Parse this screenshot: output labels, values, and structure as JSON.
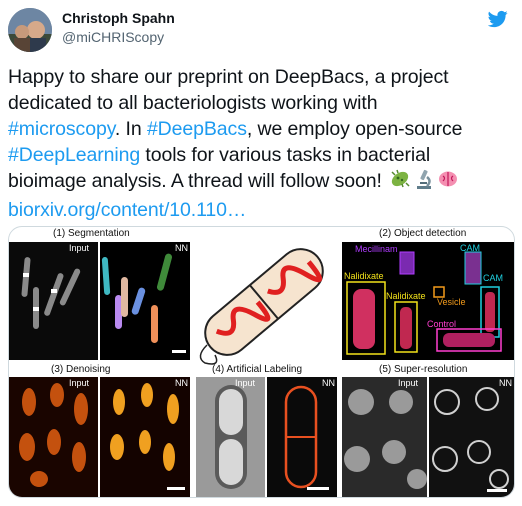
{
  "author": {
    "name": "Christoph Spahn",
    "handle": "@miCHRIScopy"
  },
  "tweet": {
    "line1": "Happy to share our preprint on DeepBacs, a project",
    "line2": "dedicated to all bacteriologists working with",
    "line3_hashtag1": "#microscopy",
    "line3_text1": ". In ",
    "line3_hashtag2": "#DeepBacs",
    "line3_text2": ", we employ open-source",
    "line4_hashtag": "#DeepLearning",
    "line4_text": " tools for various tasks in bacterial",
    "line5": "bioimage analysis. A thread will follow soon!",
    "link": "biorxiv.org/content/10.110…",
    "emojis": [
      "microbe-icon",
      "microscope-icon",
      "brain-icon"
    ]
  },
  "figure": {
    "panels": {
      "segmentation": "(1) Segmentation",
      "object_detection": "(2) Object detection",
      "denoising": "(3) Denoising",
      "artificial_labeling": "(4) Artificial Labeling",
      "super_resolution": "(5) Super-resolution"
    },
    "input_label": "Input",
    "nn_label": "NN",
    "detection_labels": {
      "mecillinam": "Mecillinam",
      "cam_top": "CAM",
      "cam_right": "CAM",
      "nalidixate_left": "Nalidixate",
      "nalidixate_mid": "Nalidixate",
      "vesicle": "Vesicle",
      "control": "Control"
    },
    "colors": {
      "mecillinam": "#b03cff",
      "cam": "#1fd0e0",
      "nalidixate": "#f2e21a",
      "vesicle": "#f29a1a",
      "control": "#ff3fd0"
    }
  }
}
